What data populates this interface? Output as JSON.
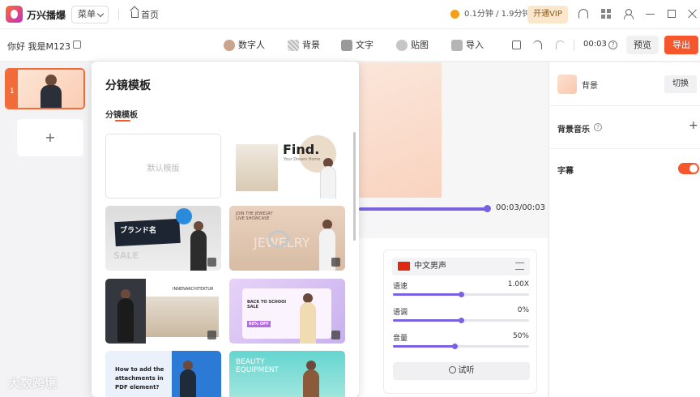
{
  "app": {
    "name": "万兴播爆",
    "menu_label": "菜单",
    "home_label": "首页",
    "quota": "0.1分钟 / 1.9分钟",
    "vip_label": "开通VIP"
  },
  "toolbar": {
    "project_name": "你好 我是M123",
    "tools": [
      "数字人",
      "背景",
      "文字",
      "贴图",
      "导入"
    ],
    "duration": "00:03",
    "preview_label": "预览",
    "export_label": "导出"
  },
  "scenes": {
    "items": [
      {
        "number": "1"
      }
    ],
    "add_label": "+"
  },
  "template_popup": {
    "title": "分镜模板",
    "tab": "分镜模板",
    "default_label": "默认模版",
    "templates": [
      {
        "title": "Find.",
        "subtitle": "Your Dream Home"
      },
      {
        "title": "ブランド名",
        "subtitle": "SALE"
      },
      {
        "title": "JEWELRY",
        "subtitle": "JOIN THE JEWELRY LIVE SHOWCASE"
      },
      {
        "title": "INNENARCHITEKTUR",
        "subtitle": ""
      },
      {
        "title": "BACK TO SCHOOl SALE",
        "subtitle": "60% OFF"
      },
      {
        "title": "How to add the attachments in PDF element?",
        "subtitle": ""
      },
      {
        "title": "BEAUTY EQUIPMENT",
        "subtitle": ""
      }
    ]
  },
  "playback": {
    "time": "00:03/00:03",
    "progress": 1.0
  },
  "voice": {
    "name": "中文男声",
    "sliders": [
      {
        "label": "语速",
        "value": "1.00X",
        "fraction": 0.5
      },
      {
        "label": "语调",
        "value": "0%",
        "fraction": 0.5
      },
      {
        "label": "音量",
        "value": "50%",
        "fraction": 0.45
      }
    ],
    "listen_label": "试听"
  },
  "right_panel": {
    "background_label": "背景",
    "switch_label": "切换",
    "music_label": "背景音乐",
    "subtitle_label": "字幕",
    "subtitle_on": true
  },
  "watermark": "大数跨境",
  "colors": {
    "accent": "#f5562c",
    "slider": "#7a61e0"
  }
}
